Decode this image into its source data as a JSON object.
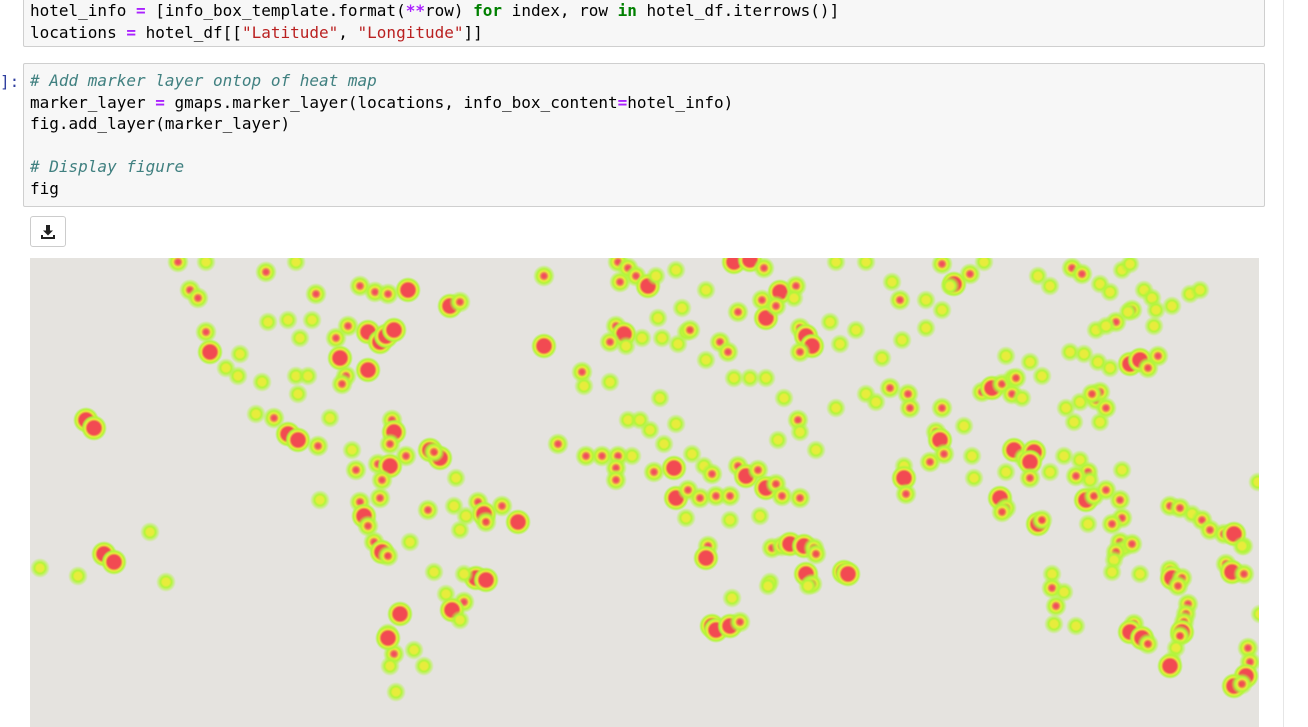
{
  "prompt": "]:",
  "cell1": {
    "line1": {
      "a": "hotel_info ",
      "b": "=",
      "c": " [info_box_template.format(",
      "d": "**",
      "e": "row) ",
      "f": "for",
      "g": " index, row ",
      "h": "in",
      "i": " hotel_df.iterrows()]"
    },
    "line2": {
      "a": "locations ",
      "b": "=",
      "c": " hotel_df[[",
      "d": "\"Latitude\"",
      "e": ", ",
      "f": "\"Longitude\"",
      "g": "]]"
    }
  },
  "cell2": {
    "line1": "# Add marker layer ontop of heat map",
    "line2": {
      "a": "marker_layer ",
      "b": "=",
      "c": " gmaps.marker_layer(locations, info_box_content",
      "d": "=",
      "e": "hotel_info)"
    },
    "line3": "fig.add_layer(marker_layer)",
    "line5": "# Display figure",
    "line6": "fig"
  },
  "download_button": {
    "icon": "download-icon"
  },
  "heatmap": {
    "background": "#e5e3df",
    "colors": {
      "outer": "#b2f53a",
      "mid": "#e8ec3c",
      "hot": "#f24a52"
    }
  }
}
